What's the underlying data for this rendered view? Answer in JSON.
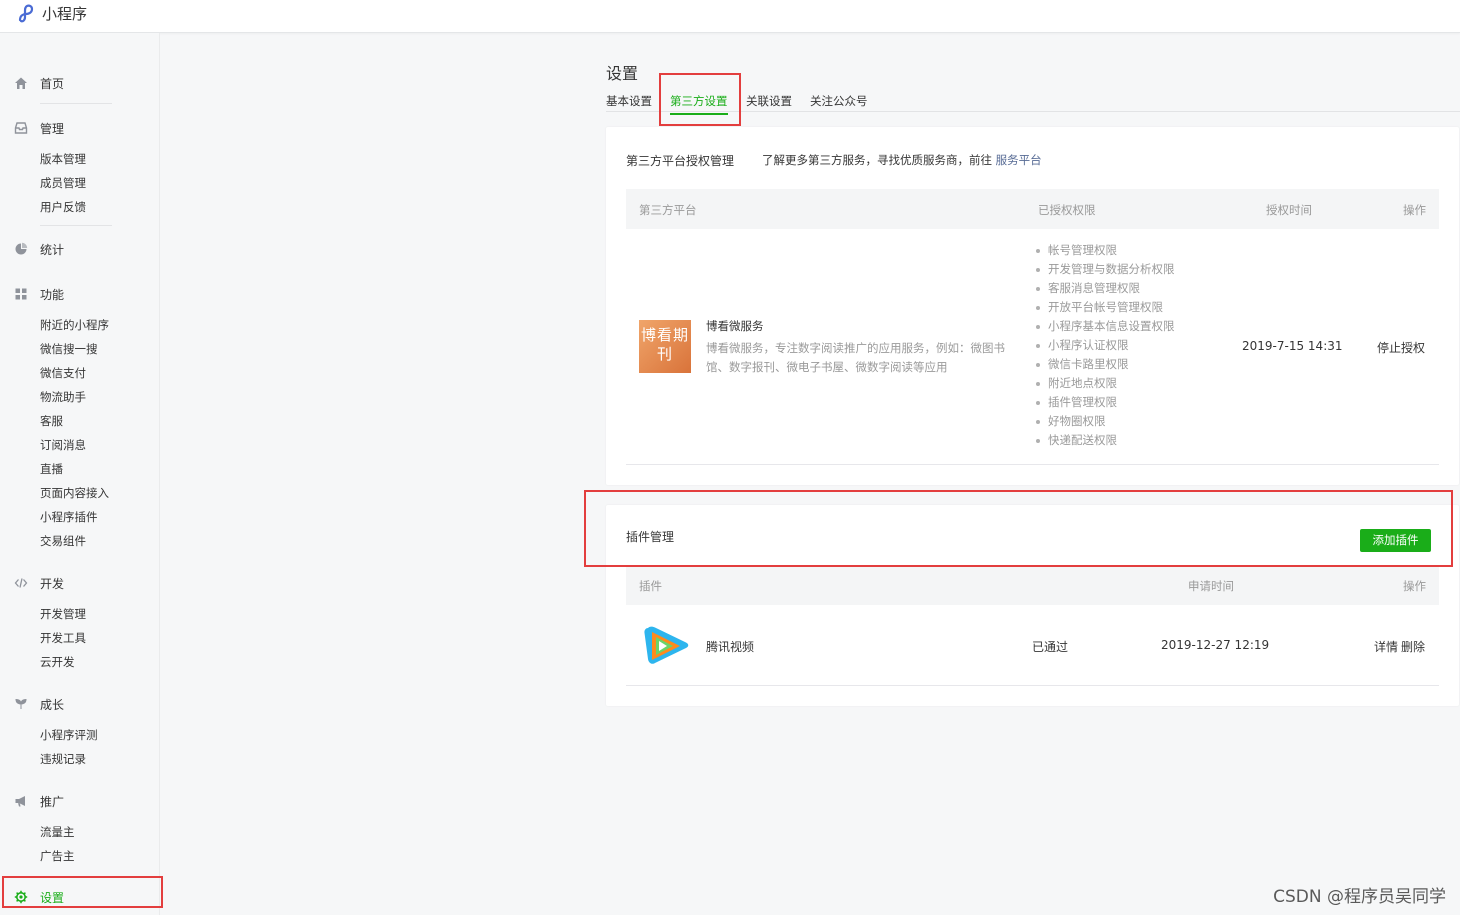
{
  "app": {
    "title": "小程序"
  },
  "sidebar": {
    "home": "首页",
    "manage": "管理",
    "manage_items": [
      "版本管理",
      "成员管理",
      "用户反馈"
    ],
    "stats": "统计",
    "features": "功能",
    "features_items": [
      "附近的小程序",
      "微信搜一搜",
      "微信支付",
      "物流助手",
      "客服",
      "订阅消息",
      "直播",
      "页面内容接入",
      "小程序插件",
      "交易组件"
    ],
    "dev": "开发",
    "dev_items": [
      "开发管理",
      "开发工具",
      "云开发"
    ],
    "growth": "成长",
    "growth_items": [
      "小程序评测",
      "违规记录"
    ],
    "promo": "推广",
    "promo_items": [
      "流量主",
      "广告主"
    ],
    "settings": "设置",
    "active_color": "#1aad19"
  },
  "main": {
    "title": "设置",
    "tabs": [
      "基本设置",
      "第三方设置",
      "关联设置",
      "关注公众号"
    ],
    "active_tab": "第三方设置"
  },
  "third_party": {
    "title": "第三方平台授权管理",
    "hint": "了解更多第三方服务，寻找优质服务商，前往",
    "hint_link": "服务平台",
    "columns": [
      "第三方平台",
      "已授权权限",
      "授权时间",
      "操作"
    ],
    "row": {
      "thumb_text": "博看期刊",
      "name": "博看微服务",
      "desc": "博看微服务，专注数字阅读推广的应用服务，例如：微图书馆、数字报刊、微电子书屋、微数字阅读等应用",
      "permissions": [
        "帐号管理权限",
        "开发管理与数据分析权限",
        "客服消息管理权限",
        "开放平台帐号管理权限",
        "小程序基本信息设置权限",
        "小程序认证权限",
        "微信卡路里权限",
        "附近地点权限",
        "插件管理权限",
        "好物圈权限",
        "快递配送权限"
      ],
      "time": "2019-7-15 14:31",
      "action": "停止授权"
    }
  },
  "plugins": {
    "title": "插件管理",
    "add_button": "添加插件",
    "columns": [
      "插件",
      "申请时间",
      "操作"
    ],
    "row": {
      "name": "腾讯视频",
      "status": "已通过",
      "time": "2019-12-27 12:19",
      "action_detail": "详情",
      "action_delete": "删除"
    }
  },
  "watermark": "CSDN @程序员吴同学",
  "colors": {
    "accent": "#1aad19",
    "link": "#576b95",
    "highlight": "#e33e3e"
  }
}
